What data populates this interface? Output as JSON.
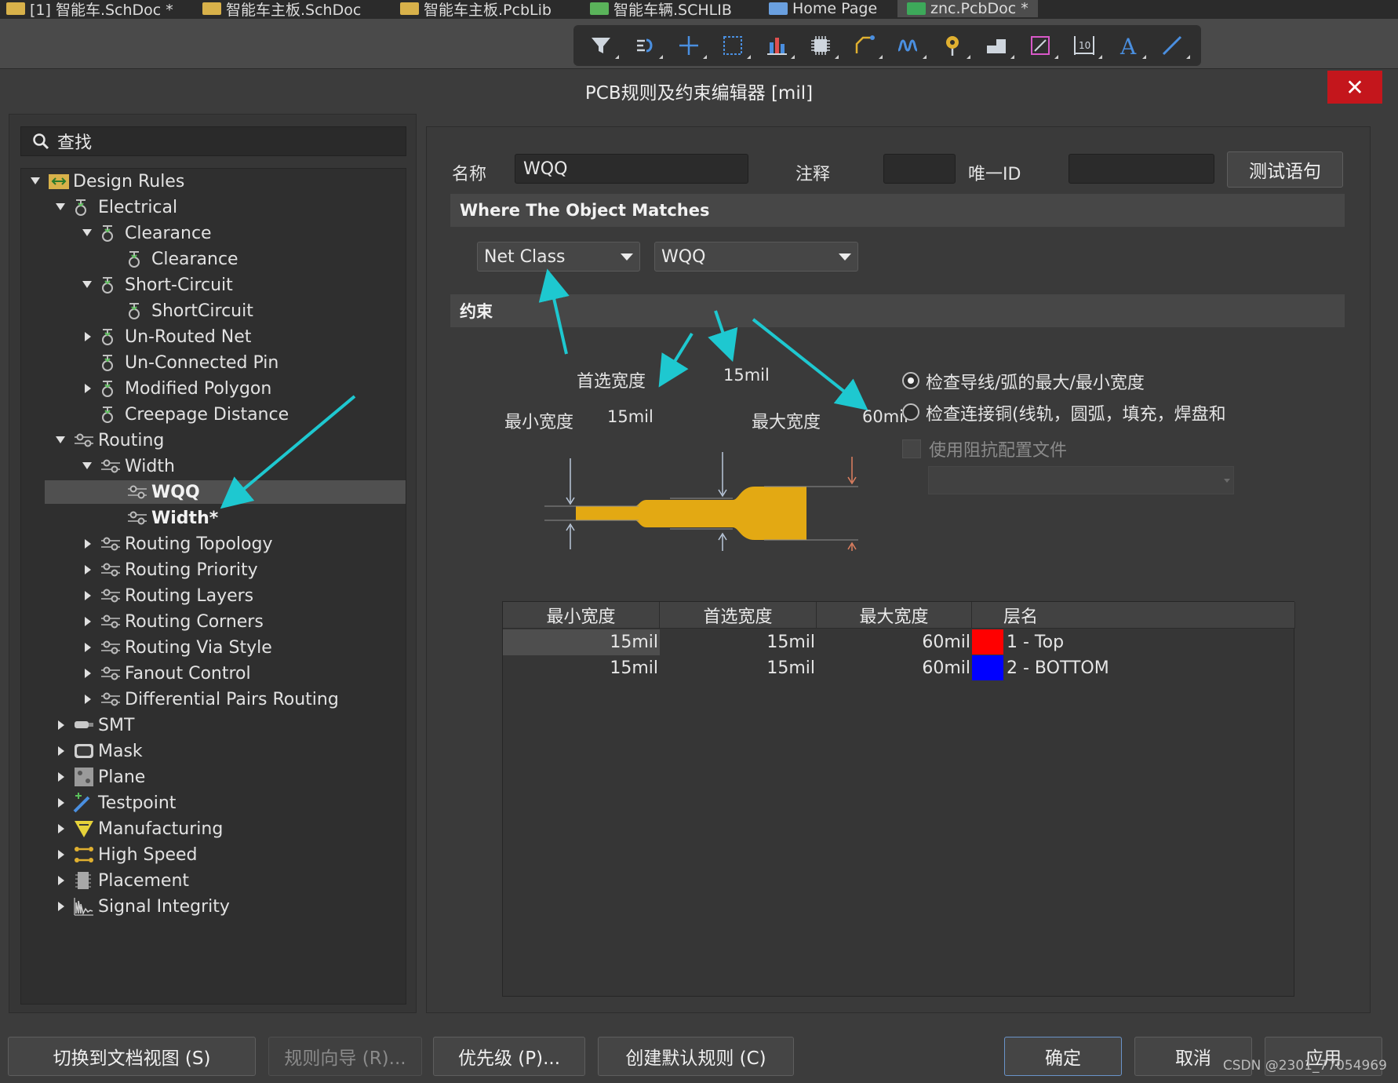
{
  "tabs": [
    {
      "label": "[1] 智能车.SchDoc *",
      "active": false
    },
    {
      "label": "智能车主板.SchDoc",
      "active": false
    },
    {
      "label": "智能车主板.PcbLib",
      "active": false
    },
    {
      "label": "智能车辆.SCHLIB",
      "active": false
    },
    {
      "label": "Home Page",
      "active": false
    },
    {
      "label": "znc.PcbDoc *",
      "active": true
    }
  ],
  "toolbar": {
    "icons": [
      "filter-icon",
      "route-icon",
      "cross-icon",
      "select-rect-icon",
      "bar-chart-icon",
      "component-icon",
      "interactive-route-icon",
      "tuning-icon",
      "via-icon",
      "fill-icon",
      "polygon-icon",
      "dimension-icon",
      "text-icon",
      "line-icon"
    ],
    "text_glyph": "A",
    "dimension_label": "10"
  },
  "dialog": {
    "title": "PCB规则及约束编辑器 [mil]",
    "close_label": "✕"
  },
  "search": {
    "label": "查找"
  },
  "tree": [
    {
      "label": "Design Rules",
      "level": 0,
      "state": "open",
      "icon": "design-rules-icon"
    },
    {
      "label": "Electrical",
      "level": 1,
      "state": "open",
      "icon": "rule-icon"
    },
    {
      "label": "Clearance",
      "level": 2,
      "state": "open",
      "icon": "rule-icon"
    },
    {
      "label": "Clearance",
      "level": 3,
      "state": "leaf",
      "icon": "rule-icon"
    },
    {
      "label": "Short-Circuit",
      "level": 2,
      "state": "open",
      "icon": "rule-icon"
    },
    {
      "label": "ShortCircuit",
      "level": 3,
      "state": "leaf",
      "icon": "rule-icon"
    },
    {
      "label": "Un-Routed Net",
      "level": 2,
      "state": "closed",
      "icon": "rule-icon"
    },
    {
      "label": "Un-Connected Pin",
      "level": 2,
      "state": "none",
      "icon": "rule-icon"
    },
    {
      "label": "Modified Polygon",
      "level": 2,
      "state": "closed",
      "icon": "rule-icon"
    },
    {
      "label": "Creepage Distance",
      "level": 2,
      "state": "none",
      "icon": "rule-icon"
    },
    {
      "label": "Routing",
      "level": 1,
      "state": "open",
      "icon": "routing-icon"
    },
    {
      "label": "Width",
      "level": 2,
      "state": "open",
      "icon": "routing-icon"
    },
    {
      "label": "WQQ",
      "level": 3,
      "state": "leaf",
      "icon": "routing-icon",
      "selected": true,
      "bold": true
    },
    {
      "label": "Width*",
      "level": 3,
      "state": "leaf",
      "icon": "routing-icon",
      "bold": true
    },
    {
      "label": "Routing Topology",
      "level": 2,
      "state": "closed",
      "icon": "routing-icon"
    },
    {
      "label": "Routing Priority",
      "level": 2,
      "state": "closed",
      "icon": "routing-icon"
    },
    {
      "label": "Routing Layers",
      "level": 2,
      "state": "closed",
      "icon": "routing-icon"
    },
    {
      "label": "Routing Corners",
      "level": 2,
      "state": "closed",
      "icon": "routing-icon"
    },
    {
      "label": "Routing Via Style",
      "level": 2,
      "state": "closed",
      "icon": "routing-icon"
    },
    {
      "label": "Fanout Control",
      "level": 2,
      "state": "closed",
      "icon": "routing-icon"
    },
    {
      "label": "Differential Pairs Routing",
      "level": 2,
      "state": "closed",
      "icon": "routing-icon"
    },
    {
      "label": "SMT",
      "level": 1,
      "state": "closed",
      "icon": "smt-icon"
    },
    {
      "label": "Mask",
      "level": 1,
      "state": "closed",
      "icon": "mask-icon"
    },
    {
      "label": "Plane",
      "level": 1,
      "state": "closed",
      "icon": "plane-icon"
    },
    {
      "label": "Testpoint",
      "level": 1,
      "state": "closed",
      "icon": "testpoint-icon"
    },
    {
      "label": "Manufacturing",
      "level": 1,
      "state": "closed",
      "icon": "manufacturing-icon"
    },
    {
      "label": "High Speed",
      "level": 1,
      "state": "closed",
      "icon": "high-speed-icon"
    },
    {
      "label": "Placement",
      "level": 1,
      "state": "closed",
      "icon": "placement-icon"
    },
    {
      "label": "Signal Integrity",
      "level": 1,
      "state": "closed",
      "icon": "signal-integrity-icon"
    }
  ],
  "rule": {
    "name_label": "名称",
    "name_value": "WQQ",
    "comment_label": "注释",
    "comment_value": "",
    "uid_label": "唯一ID",
    "uid_value": "",
    "test_button": "测试语句"
  },
  "match": {
    "section_title": "Where The Object Matches",
    "type_value": "Net Class",
    "class_value": "WQQ"
  },
  "constraints": {
    "section_title": "约束",
    "preferred_label": "首选宽度",
    "preferred_value": "15mil",
    "min_label": "最小宽度",
    "min_value": "15mil",
    "max_label": "最大宽度",
    "max_value": "60mil",
    "trace_color": "#e3a913",
    "options": [
      {
        "label": "检查导线/弧的最大/最小宽度",
        "selected": true
      },
      {
        "label": "检查连接铜(线轨，圆弧，填充，焊盘和",
        "selected": false
      }
    ],
    "impedance_label": "使用阻抗配置文件",
    "impedance_checked": false
  },
  "table": {
    "headers": [
      "最小宽度",
      "首选宽度",
      "最大宽度",
      "层名"
    ],
    "rows": [
      {
        "min": "15mil",
        "pref": "15mil",
        "max": "60mil",
        "color": "#ff0000",
        "layer": "1 - Top"
      },
      {
        "min": "15mil",
        "pref": "15mil",
        "max": "60mil",
        "color": "#0000ff",
        "layer": "2 - BOTTOM"
      }
    ]
  },
  "footer": {
    "doc_view": "切换到文档视图 (S)",
    "wizard": "规则向导 (R)...",
    "priority": "优先级 (P)...",
    "create_default": "创建默认规则 (C)",
    "ok": "确定",
    "cancel": "取消",
    "apply": "应用"
  },
  "annotation_color": "#1ec8d0",
  "watermark": "CSDN @2301_77054969"
}
